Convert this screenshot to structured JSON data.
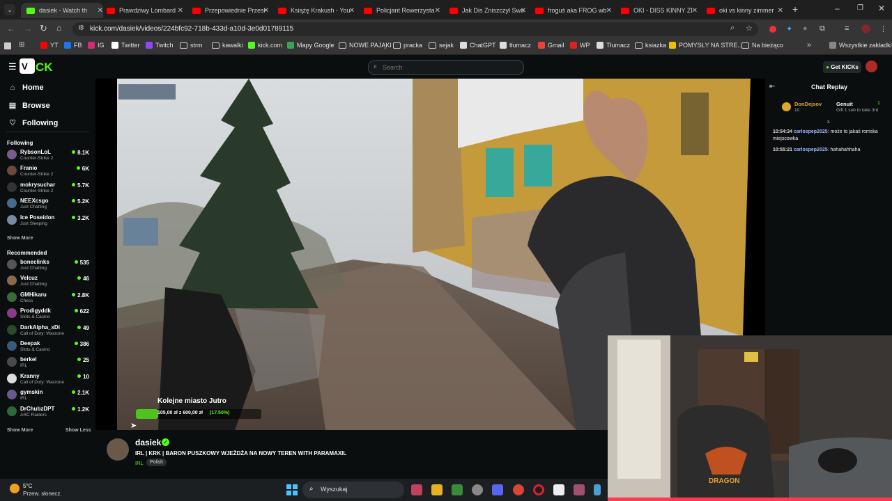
{
  "browser": {
    "tabs": [
      {
        "label": "dasiek - Watch th",
        "favicon": "#53fc18",
        "active": true
      },
      {
        "label": "Prawdziwy Lombard",
        "favicon": "#ff0000"
      },
      {
        "label": "Przepowiednie Przesł",
        "favicon": "#ff0000"
      },
      {
        "label": "Książę Krakush - You",
        "favicon": "#ff0000"
      },
      {
        "label": "Policjant Rowerzysta",
        "favicon": "#ff0000"
      },
      {
        "label": "Jak Dis Zniszczył Swo",
        "favicon": "#ff0000"
      },
      {
        "label": "froguś aka FROG wb",
        "favicon": "#ff0000"
      },
      {
        "label": "OKI - DISS KINNY ZI",
        "favicon": "#ff0000"
      },
      {
        "label": "oki vs kinny zimmer",
        "favicon": "#ff0000"
      }
    ],
    "url": "kick.com/dasiek/videos/224bfc92-718b-433d-a10d-3e0d01789115",
    "bookmarks": [
      {
        "label": "YT",
        "icon": "youtube-icon"
      },
      {
        "label": "FB",
        "icon": "facebook-icon"
      },
      {
        "label": "IG",
        "icon": "instagram-icon"
      },
      {
        "label": "Twitter",
        "icon": "x-icon"
      },
      {
        "label": "Twitch",
        "icon": "twitch-icon"
      },
      {
        "label": "strm",
        "icon": "folder-icon"
      },
      {
        "label": "kawalki",
        "icon": "folder-icon"
      },
      {
        "label": "kick.com",
        "icon": "kick-icon"
      },
      {
        "label": "Mapy Google",
        "icon": "maps-icon"
      },
      {
        "label": "NOWE PAJĄKI",
        "icon": "folder-icon"
      },
      {
        "label": "pracka",
        "icon": "folder-icon"
      },
      {
        "label": "sejak",
        "icon": "folder-icon"
      },
      {
        "label": "ChatGPT",
        "icon": "chatgpt-icon"
      },
      {
        "label": "tłumacz",
        "icon": "translate-icon"
      },
      {
        "label": "Gmail",
        "icon": "gmail-icon"
      },
      {
        "label": "WP",
        "icon": "wp-icon"
      },
      {
        "label": "Tłumacz",
        "icon": "translate-icon"
      },
      {
        "label": "ksiazka",
        "icon": "folder-icon"
      },
      {
        "label": "POMYSŁY NA STRE...",
        "icon": "note-icon"
      },
      {
        "label": "Na bieżąco",
        "icon": "folder-icon"
      }
    ],
    "all_bookmarks": "Wszystkie zakładki",
    "chevron": "»"
  },
  "kick": {
    "search_placeholder": "Search",
    "get_kicks": "Get KICKs",
    "nav": {
      "home": "Home",
      "browse": "Browse",
      "following": "Following"
    },
    "following_title": "Following",
    "following": [
      {
        "name": "RybsonLoL",
        "game": "Counter-Strike 2",
        "viewers": "8.1K",
        "color": "#7a5c8a"
      },
      {
        "name": "Franio",
        "game": "Counter-Strike 2",
        "viewers": "6K",
        "color": "#6b4a3a"
      },
      {
        "name": "mokrysuchar",
        "game": "Counter-Strike 2",
        "viewers": "5.7K",
        "color": "#333333"
      },
      {
        "name": "NEEXcsgo",
        "game": "Just Chatting",
        "viewers": "5.2K",
        "color": "#4a6a8a"
      },
      {
        "name": "Ice Poseidon",
        "game": "Just Sleeping",
        "viewers": "3.2K",
        "color": "#7a8aa0"
      }
    ],
    "show_more": "Show More",
    "recommended_title": "Recommended",
    "recommended": [
      {
        "name": "boneclinks",
        "game": "Just Chatting",
        "viewers": "535",
        "color": "#555555"
      },
      {
        "name": "Velcuz",
        "game": "Just Chatting",
        "viewers": "46",
        "color": "#8a6a4a"
      },
      {
        "name": "GMHikaru",
        "game": "Chess",
        "viewers": "2.8K",
        "color": "#3a6a3a"
      },
      {
        "name": "Prodigyddk",
        "game": "Slots & Casino",
        "viewers": "622",
        "color": "#8a3a8a"
      },
      {
        "name": "DarkAlpha_xDi",
        "game": "Call of Duty: Warzone",
        "viewers": "49",
        "color": "#2a4a2a"
      },
      {
        "name": "Deepak",
        "game": "Slots & Casino",
        "viewers": "386",
        "color": "#3a5a7a"
      },
      {
        "name": "berkel",
        "game": "IRL",
        "viewers": "25",
        "color": "#4a4a4a"
      },
      {
        "name": "Kranny",
        "game": "Call of Duty: Warzone",
        "viewers": "10",
        "color": "#dddddd"
      },
      {
        "name": "gymskin",
        "game": "IRL",
        "viewers": "2.1K",
        "color": "#6a5a8a"
      },
      {
        "name": "DrChubzDPT",
        "game": "ARC Raiders",
        "viewers": "1.2K",
        "color": "#2a6a3a"
      }
    ],
    "show_less": "Show Less",
    "chat": {
      "title": "Chat Replay",
      "pinned_user": "DonDejsov",
      "pinned_count": "10",
      "gift_user": "Genuit",
      "gift_count": "1",
      "gift_text": "Gift 1 sub to take 3rd",
      "messages": [
        {
          "time": "10:54:34",
          "user": "carlospep2025",
          "text": "może to jakaś romska miejscowka"
        },
        {
          "time": "10:55:21",
          "user": "carlospep2025",
          "text": "hahahahhaha"
        }
      ]
    },
    "overlay": {
      "title": "Kolejne miasto Jutro",
      "progress_text": "105,00 zł z 600,00 zł",
      "percent_text": "(17.50%)",
      "progress": 0.175
    },
    "streamer": {
      "name": "dasiek",
      "title": "IRL | KRK | BARON PUSZKOWY WJEŻDŻA NA NOWY TEREN WITH PARAMAXIL",
      "tags": [
        "IRL",
        "Polish"
      ]
    }
  },
  "taskbar": {
    "temp": "5°C",
    "weather": "Przew. słonecz.",
    "search": "Wyszukaj"
  }
}
